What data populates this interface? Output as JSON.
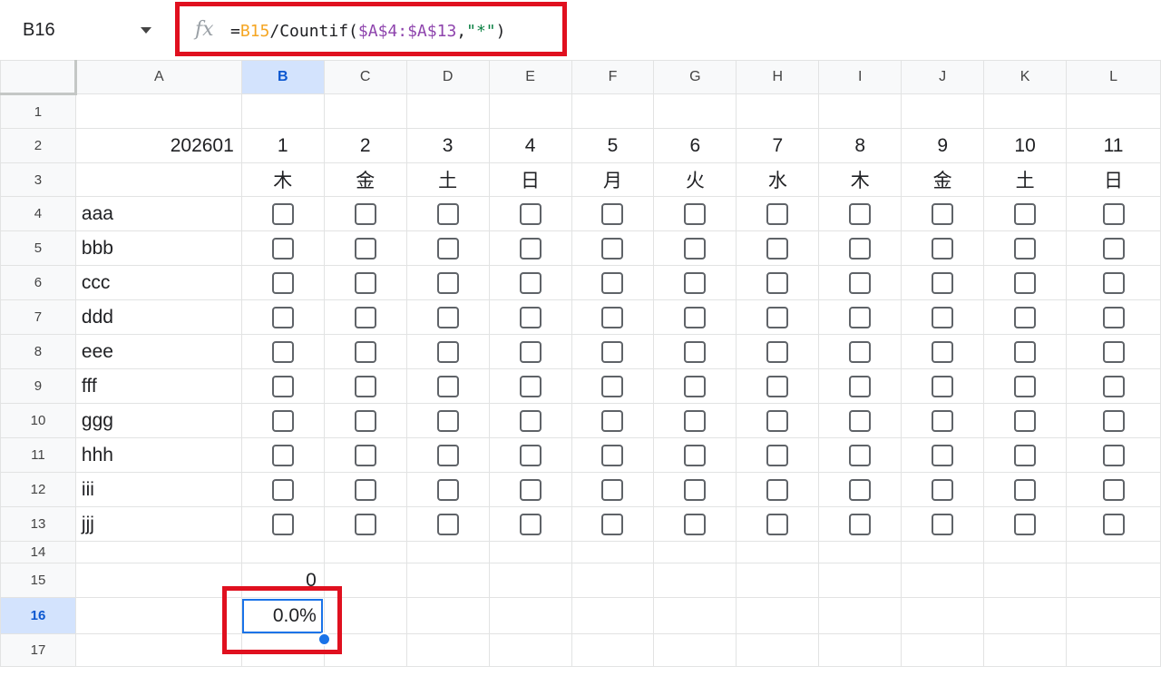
{
  "name_box": {
    "value": "B16"
  },
  "formula_bar": {
    "fx_icon": "fx-icon",
    "formula_parts": {
      "eq": "=",
      "ref1": "B15",
      "mid": "/Countif(",
      "ref2": "$A$4:$A$13",
      "comma": ",",
      "str": "\"*\"",
      "close": ")"
    }
  },
  "columns": [
    "A",
    "B",
    "C",
    "D",
    "E",
    "F",
    "G",
    "H",
    "I",
    "J",
    "K",
    "L"
  ],
  "selected_column": "B",
  "rows": [
    "1",
    "2",
    "3",
    "4",
    "5",
    "6",
    "7",
    "8",
    "9",
    "10",
    "11",
    "12",
    "13",
    "14",
    "15",
    "16",
    "17"
  ],
  "selected_row": "16",
  "sheet": {
    "a2": "202601",
    "days": [
      "1",
      "2",
      "3",
      "4",
      "5",
      "6",
      "7",
      "8",
      "9",
      "10",
      "11"
    ],
    "weekdays": [
      "木",
      "金",
      "土",
      "日",
      "月",
      "火",
      "水",
      "木",
      "金",
      "土",
      "日"
    ],
    "names": [
      "aaa",
      "bbb",
      "ccc",
      "ddd",
      "eee",
      "fff",
      "ggg",
      "hhh",
      "iii",
      "jjj"
    ],
    "b15": "0",
    "b16": "0.0%"
  },
  "checkbox_state": "unchecked",
  "colors": {
    "highlight": "#e0101f",
    "selection": "#1a73e8",
    "ref1": "#f5a623",
    "ref2": "#8e44ad",
    "string": "#0b8043"
  }
}
